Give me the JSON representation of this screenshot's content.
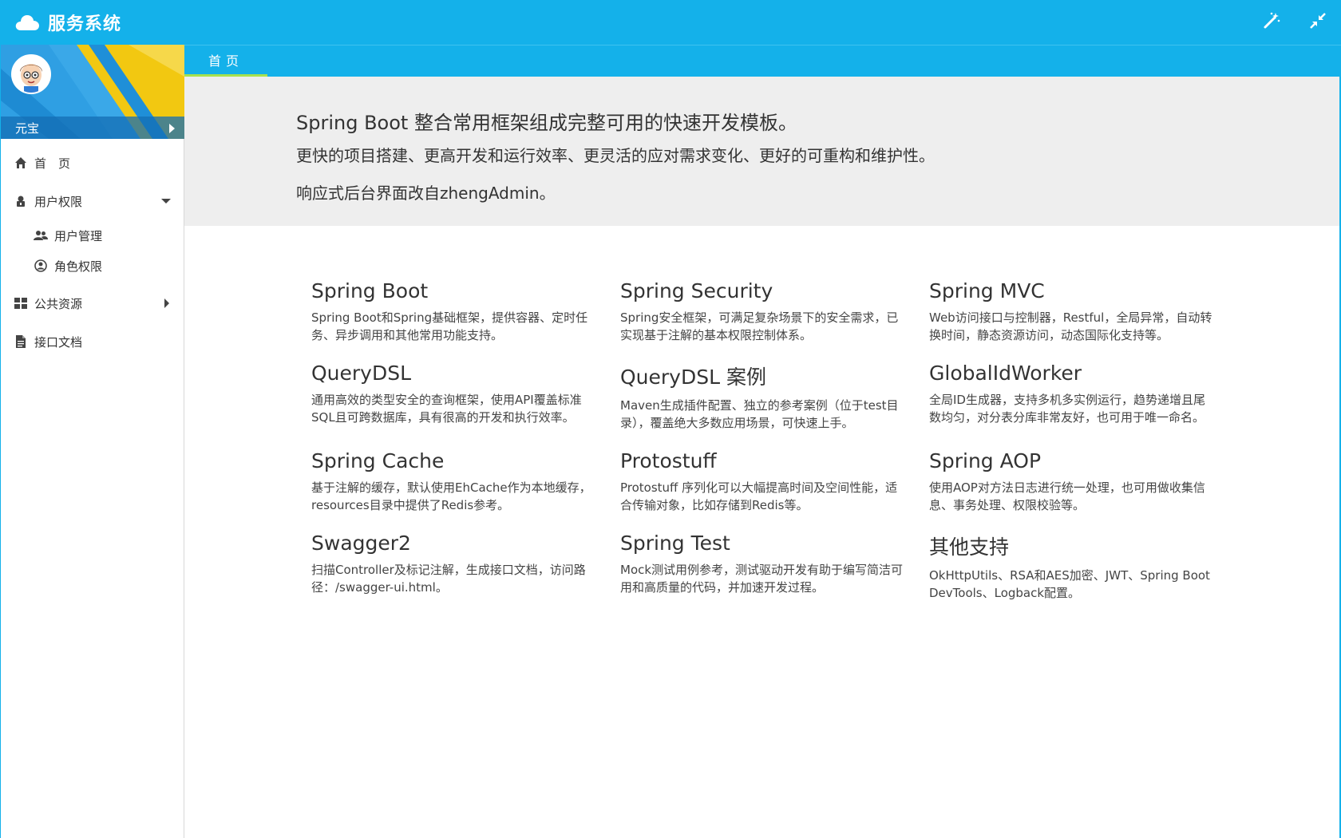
{
  "app": {
    "title": "服务系统"
  },
  "colors": {
    "primary": "#14b1ea",
    "tab_underline": "#a6e24d",
    "jumbotron_bg": "#eeeeee"
  },
  "navbar": {
    "actions": [
      {
        "icon": "magic-wand-icon"
      },
      {
        "icon": "compress-icon"
      }
    ]
  },
  "user": {
    "name": "元宝"
  },
  "sidebar": {
    "items": [
      {
        "label": "首　页",
        "icon": "home-icon"
      },
      {
        "label": "用户权限",
        "icon": "user-lock-icon",
        "expanded": true,
        "children": [
          {
            "label": "用户管理",
            "icon": "users-icon"
          },
          {
            "label": "角色权限",
            "icon": "user-circle-icon"
          }
        ]
      },
      {
        "label": "公共资源",
        "icon": "grid-icon",
        "expanded": false
      },
      {
        "label": "接口文档",
        "icon": "file-icon"
      }
    ]
  },
  "tabs": [
    {
      "label": "首页",
      "active": true
    }
  ],
  "jumbotron": {
    "title": "Spring Boot 整合常用框架组成完整可用的快速开发模板。",
    "line1": "更快的项目搭建、更高开发和运行效率、更灵活的应对需求变化、更好的可重构和维护性。",
    "line2": "响应式后台界面改自zhengAdmin。"
  },
  "features": [
    {
      "title": "Spring Boot",
      "desc": "Spring Boot和Spring基础框架，提供容器、定时任务、异步调用和其他常用功能支持。"
    },
    {
      "title": "Spring Security",
      "desc": "Spring安全框架，可满足复杂场景下的安全需求，已实现基于注解的基本权限控制体系。"
    },
    {
      "title": "Spring MVC",
      "desc": "Web访问接口与控制器，Restful，全局异常，自动转换时间，静态资源访问，动态国际化支持等。"
    },
    {
      "title": "QueryDSL",
      "desc": "通用高效的类型安全的查询框架，使用API覆盖标准SQL且可跨数据库，具有很高的开发和执行效率。"
    },
    {
      "title": "QueryDSL 案例",
      "desc": "Maven生成插件配置、独立的参考案例（位于test目录），覆盖绝大多数应用场景，可快速上手。"
    },
    {
      "title": "GlobalIdWorker",
      "desc": "全局ID生成器，支持多机多实例运行，趋势递增且尾数均匀，对分表分库非常友好，也可用于唯一命名。"
    },
    {
      "title": "Spring Cache",
      "desc": "基于注解的缓存，默认使用EhCache作为本地缓存，resources目录中提供了Redis参考。"
    },
    {
      "title": "Protostuff",
      "desc": "Protostuff 序列化可以大幅提高时间及空间性能，适合传输对象，比如存储到Redis等。"
    },
    {
      "title": "Spring AOP",
      "desc": "使用AOP对方法日志进行统一处理，也可用做收集信息、事务处理、权限校验等。"
    },
    {
      "title": "Swagger2",
      "desc": "扫描Controller及标记注解，生成接口文档，访问路径：/swagger-ui.html。"
    },
    {
      "title": "Spring Test",
      "desc": "Mock测试用例参考，测试驱动开发有助于编写简洁可用和高质量的代码，并加速开发过程。"
    },
    {
      "title": "其他支持",
      "desc": "OkHttpUtils、RSA和AES加密、JWT、Spring Boot DevTools、Logback配置。"
    }
  ]
}
